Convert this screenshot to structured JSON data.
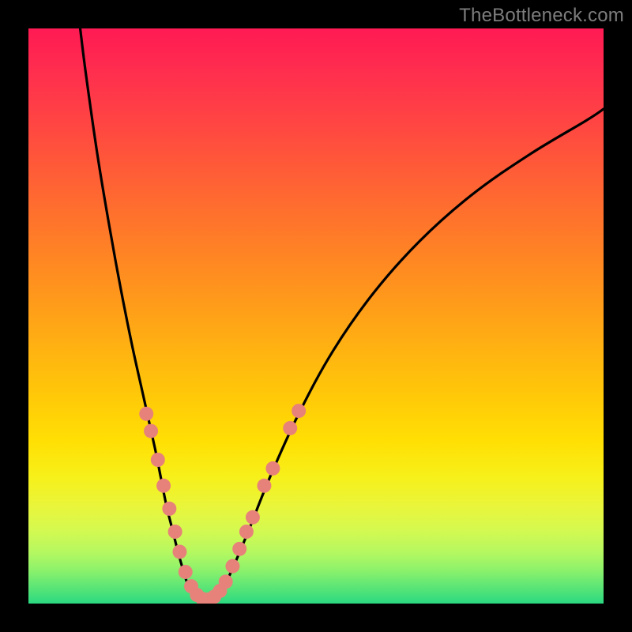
{
  "watermark": "TheBottleneck.com",
  "colors": {
    "frame": "#000000",
    "curve_stroke": "#000000",
    "marker_fill": "#e7827a",
    "marker_stroke": "#d66b63"
  },
  "chart_data": {
    "type": "line",
    "title": "",
    "xlabel": "",
    "ylabel": "",
    "xlim": [
      0,
      100
    ],
    "ylim": [
      0,
      100
    ],
    "series": [
      {
        "name": "left-branch",
        "x": [
          9,
          10,
          12,
          14,
          16,
          18,
          20,
          22,
          23,
          24,
          25,
          26,
          27,
          28
        ],
        "y": [
          100,
          92,
          78,
          66,
          55,
          45,
          36,
          27,
          22,
          17,
          13,
          9,
          5.5,
          2.5
        ]
      },
      {
        "name": "valley",
        "x": [
          28,
          29,
          30,
          31,
          32,
          33
        ],
        "y": [
          2.5,
          1.2,
          0.6,
          0.4,
          0.6,
          1.2
        ]
      },
      {
        "name": "right-branch",
        "x": [
          33,
          35,
          38,
          42,
          47,
          53,
          60,
          68,
          77,
          87,
          97,
          100
        ],
        "y": [
          1.2,
          5,
          12,
          22,
          33,
          44,
          54,
          63,
          71,
          78,
          84,
          86
        ]
      }
    ],
    "markers": [
      {
        "x": 20.5,
        "y": 33
      },
      {
        "x": 21.3,
        "y": 30
      },
      {
        "x": 22.5,
        "y": 25
      },
      {
        "x": 23.5,
        "y": 20.5
      },
      {
        "x": 24.5,
        "y": 16.5
      },
      {
        "x": 25.5,
        "y": 12.5
      },
      {
        "x": 26.3,
        "y": 9
      },
      {
        "x": 27.3,
        "y": 5.5
      },
      {
        "x": 28.3,
        "y": 3
      },
      {
        "x": 29.3,
        "y": 1.5
      },
      {
        "x": 30.3,
        "y": 0.8
      },
      {
        "x": 31.3,
        "y": 0.7
      },
      {
        "x": 32.3,
        "y": 1.2
      },
      {
        "x": 33.3,
        "y": 2.2
      },
      {
        "x": 34.3,
        "y": 3.8
      },
      {
        "x": 35.5,
        "y": 6.5
      },
      {
        "x": 36.7,
        "y": 9.5
      },
      {
        "x": 37.9,
        "y": 12.5
      },
      {
        "x": 39.0,
        "y": 15
      },
      {
        "x": 41.0,
        "y": 20.5
      },
      {
        "x": 42.5,
        "y": 23.5
      },
      {
        "x": 45.5,
        "y": 30.5
      },
      {
        "x": 47.0,
        "y": 33.5
      }
    ],
    "marker_radius_px": 9
  }
}
